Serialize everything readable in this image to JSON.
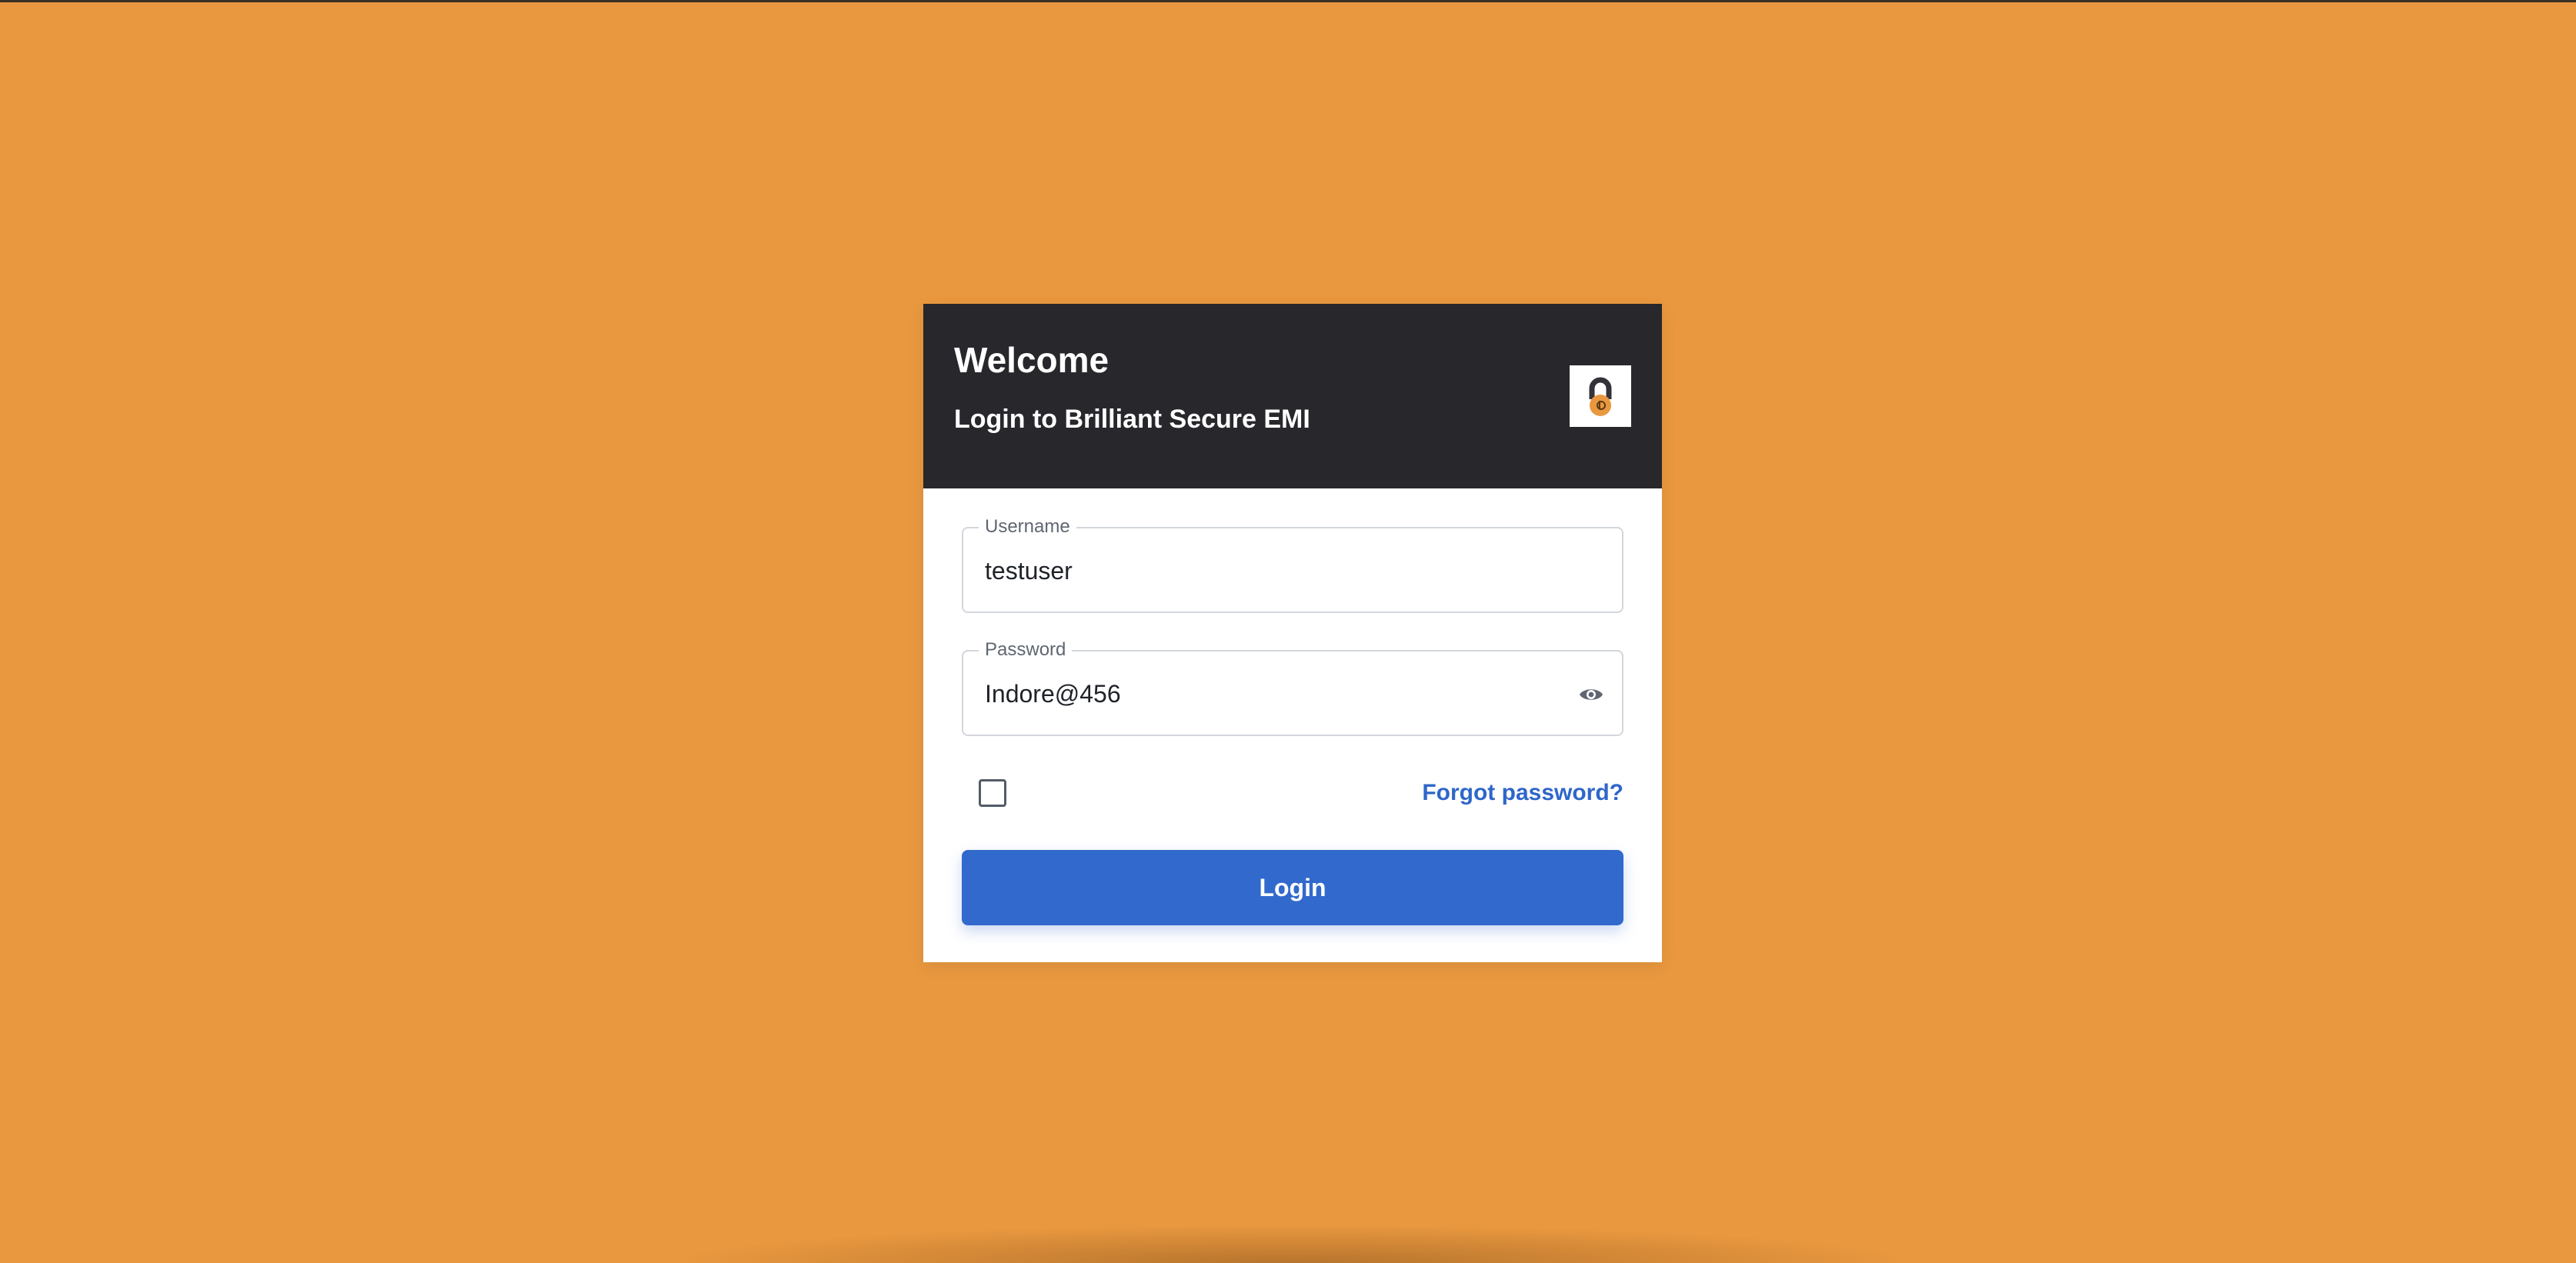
{
  "page": {
    "background_color": "#e9983f"
  },
  "login_card": {
    "header": {
      "title": "Welcome",
      "subtitle": "Login to Brilliant Secure EMI",
      "logo_icon": "padlock-logo-icon",
      "background_color": "#27272c"
    },
    "username": {
      "label": "Username",
      "value": "testuser",
      "placeholder": ""
    },
    "password": {
      "label": "Password",
      "value": "Indore@456",
      "placeholder": "",
      "toggle_icon": "eye-icon"
    },
    "remember_checkbox": {
      "checked": false
    },
    "forgot_password_label": "Forgot password?",
    "login_button_label": "Login",
    "accent_color": "#3269cc"
  }
}
